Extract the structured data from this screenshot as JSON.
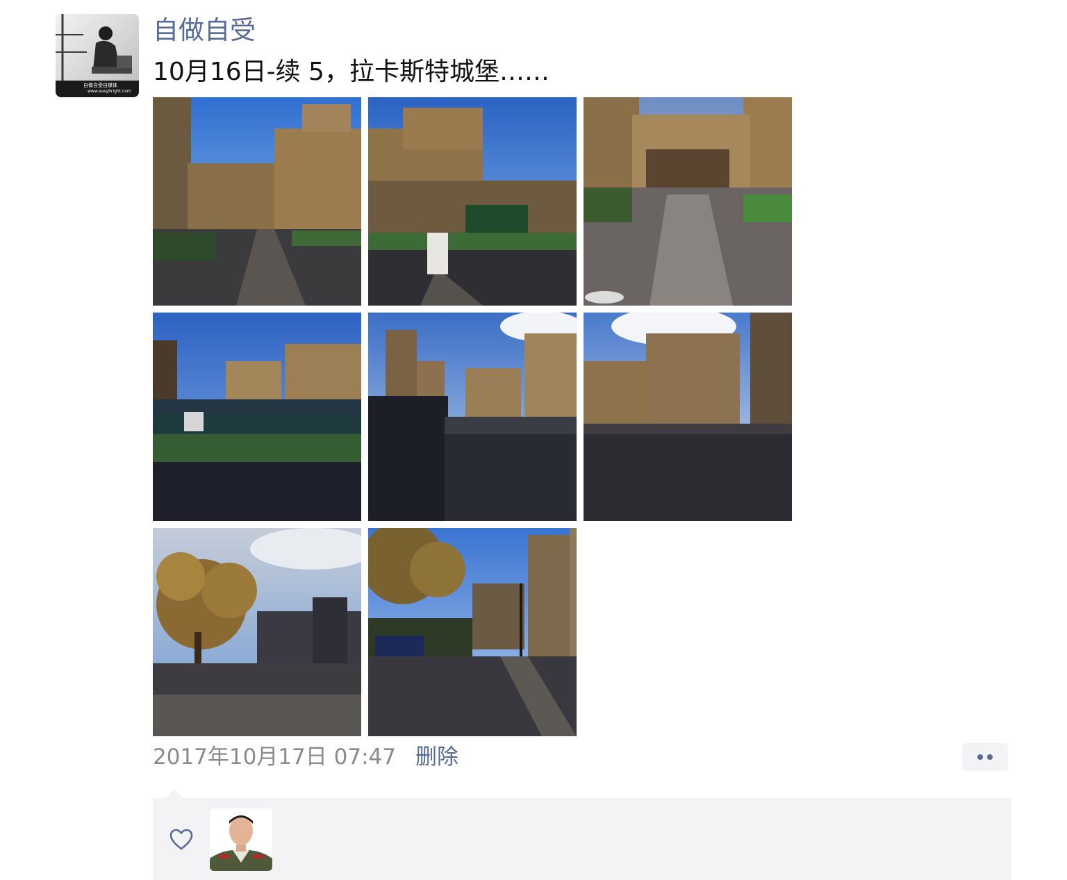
{
  "post": {
    "author": "自做自受",
    "text": "10月16日-续 5，拉卡斯特城堡……",
    "timestamp": "2017年10月17日 07:47",
    "delete_label": "删除",
    "avatar_caption": "自做自受自媒体",
    "avatar_caption_url": "www.easybright.com",
    "photos": [
      {
        "name": "castle-courtyard-photo"
      },
      {
        "name": "castle-keep-photo"
      },
      {
        "name": "castle-gate-photo"
      },
      {
        "name": "castle-towers-photo"
      },
      {
        "name": "castle-tower-shadow-photo"
      },
      {
        "name": "castle-wall-photo"
      },
      {
        "name": "autumn-tree-photo"
      },
      {
        "name": "street-view-photo"
      }
    ]
  },
  "actions": {
    "more_icon": "more-dots-icon"
  },
  "likes": {
    "icon": "heart-outline-icon",
    "users": [
      {
        "name": "liker-avatar"
      }
    ]
  },
  "colors": {
    "link": "#576b95",
    "timestamp": "#8a8a8a",
    "panel": "#f3f3f5"
  }
}
